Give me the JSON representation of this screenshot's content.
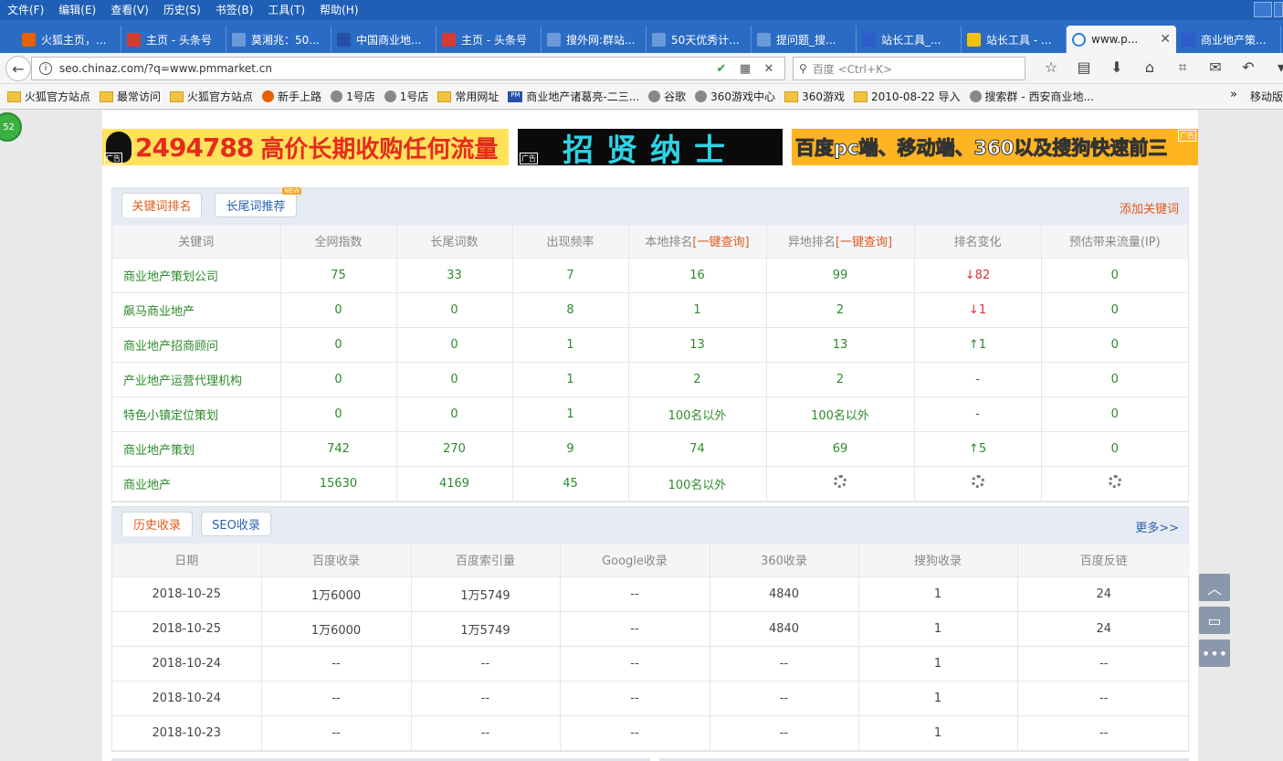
{
  "menubar": {
    "items": [
      "文件(F)",
      "编辑(E)",
      "查看(V)",
      "历史(S)",
      "书签(B)",
      "工具(T)",
      "帮助(H)"
    ]
  },
  "tabs": [
    {
      "label": "火狐主页，...",
      "icon": "firefox-icon",
      "color": "#e66000"
    },
    {
      "label": "主页 - 头条号",
      "icon": "toutiao-icon",
      "color": "#d43c33"
    },
    {
      "label": "莫湘兆：50...",
      "icon": "sogou-icon",
      "color": "#6b9ad8"
    },
    {
      "label": "中国商业地...",
      "icon": "pm-icon",
      "color": "#2650a5"
    },
    {
      "label": "主页 - 头条号",
      "icon": "toutiao-icon",
      "color": "#d43c33"
    },
    {
      "label": "搜外网:群站...",
      "icon": "sogou-icon",
      "color": "#6b9ad8"
    },
    {
      "label": "50天优秀计...",
      "icon": "sogou-icon",
      "color": "#6b9ad8"
    },
    {
      "label": "提问题_搜...",
      "icon": "sogou-icon",
      "color": "#6b9ad8"
    },
    {
      "label": "站长工具_...",
      "icon": "baidu-icon",
      "color": "#2e5cc9"
    },
    {
      "label": "站长工具 - ...",
      "icon": "chinaz-icon",
      "color": "#f3c300"
    },
    {
      "label": "www.p...",
      "icon": "loading-icon",
      "color": "#ffffff",
      "active": true
    },
    {
      "label": "商业地产策...",
      "icon": "baidu-icon",
      "color": "#2e5cc9"
    }
  ],
  "navbar": {
    "url": "seo.chinaz.com/?q=www.pmmarket.cn",
    "search_placeholder": "百度 <Ctrl+K>"
  },
  "bookmarks": [
    {
      "label": "火狐官方站点",
      "icon": "folder"
    },
    {
      "label": "最常访问",
      "icon": "folder"
    },
    {
      "label": "火狐官方站点",
      "icon": "folder"
    },
    {
      "label": "新手上路",
      "icon": "firefox"
    },
    {
      "label": "1号店",
      "icon": "globe"
    },
    {
      "label": "1号店",
      "icon": "globe"
    },
    {
      "label": "常用网址",
      "icon": "folder"
    },
    {
      "label": "商业地产诸葛亮-二三...",
      "icon": "pm"
    },
    {
      "label": "谷歌",
      "icon": "globe"
    },
    {
      "label": "360游戏中心",
      "icon": "globe"
    },
    {
      "label": "360游戏",
      "icon": "folder"
    },
    {
      "label": "2010-08-22 导入",
      "icon": "folder"
    },
    {
      "label": "搜索群 - 西安商业地...",
      "icon": "globe"
    }
  ],
  "bookmarks_more": "»",
  "mobile_bookmarks": "移动版",
  "side_bubble": "52",
  "ads": {
    "ad1_number": "2494788",
    "ad1_text": "高价长期收购任何流量",
    "ad1_tag": "广告",
    "ad2_text": "招贤纳士",
    "ad2_tag": "广告",
    "ad3_text_a": "百度pc端、移动端、360以及搜狗",
    "ad3_text_b": "快速前三",
    "ad3_tag": "广告"
  },
  "keyword_panel": {
    "tab_active": "关键词排名",
    "tab_inactive": "长尾词推荐",
    "new_badge": "NEW",
    "add_keyword": "添加关键词",
    "headers": [
      "关键词",
      "全网指数",
      "长尾词数",
      "出现频率",
      "本地排名",
      "异地排名",
      "排名变化",
      "预估带来流量(IP)"
    ],
    "query_link": "[一键查询]",
    "rows": [
      {
        "keyword": "商业地产策划公司",
        "index": "75",
        "longtail": "33",
        "freq": "7",
        "local": "16",
        "remote": "99",
        "change": "82",
        "change_dir": "down",
        "traffic": "0"
      },
      {
        "keyword": "飙马商业地产",
        "index": "0",
        "longtail": "0",
        "freq": "8",
        "local": "1",
        "remote": "2",
        "change": "1",
        "change_dir": "down",
        "traffic": "0"
      },
      {
        "keyword": "商业地产招商顾问",
        "index": "0",
        "longtail": "0",
        "freq": "1",
        "local": "13",
        "remote": "13",
        "change": "1",
        "change_dir": "up",
        "traffic": "0"
      },
      {
        "keyword": "产业地产运营代理机构",
        "index": "0",
        "longtail": "0",
        "freq": "1",
        "local": "2",
        "remote": "2",
        "change": "-",
        "change_dir": "none",
        "traffic": "0"
      },
      {
        "keyword": "特色小镇定位策划",
        "index": "0",
        "longtail": "0",
        "freq": "1",
        "local": "100名以外",
        "remote": "100名以外",
        "change": "-",
        "change_dir": "none",
        "traffic": "0"
      },
      {
        "keyword": "商业地产策划",
        "index": "742",
        "longtail": "270",
        "freq": "9",
        "local": "74",
        "remote": "69",
        "change": "5",
        "change_dir": "up",
        "traffic": "0"
      },
      {
        "keyword": "商业地产",
        "index": "15630",
        "longtail": "4169",
        "freq": "45",
        "local": "100名以外",
        "remote": "",
        "change": "",
        "change_dir": "loading",
        "traffic": ""
      }
    ]
  },
  "history_panel": {
    "tab_active": "历史收录",
    "tab_inactive": "SEO收录",
    "more": "更多>>",
    "headers": [
      "日期",
      "百度收录",
      "百度索引量",
      "Google收录",
      "360收录",
      "搜狗收录",
      "百度反链"
    ],
    "rows": [
      [
        "2018-10-25",
        "1万6000",
        "1万5749",
        "--",
        "4840",
        "1",
        "24"
      ],
      [
        "2018-10-25",
        "1万6000",
        "1万5749",
        "--",
        "4840",
        "1",
        "24"
      ],
      [
        "2018-10-24",
        "--",
        "--",
        "--",
        "--",
        "1",
        "--"
      ],
      [
        "2018-10-24",
        "--",
        "--",
        "--",
        "--",
        "1",
        "--"
      ],
      [
        "2018-10-23",
        "--",
        "--",
        "--",
        "--",
        "1",
        "--"
      ]
    ]
  },
  "colors": {
    "green_text": "#2d8a2d",
    "orange_accent": "#e05a1b",
    "blue_link": "#2a63b0",
    "down_red": "#e03030"
  }
}
